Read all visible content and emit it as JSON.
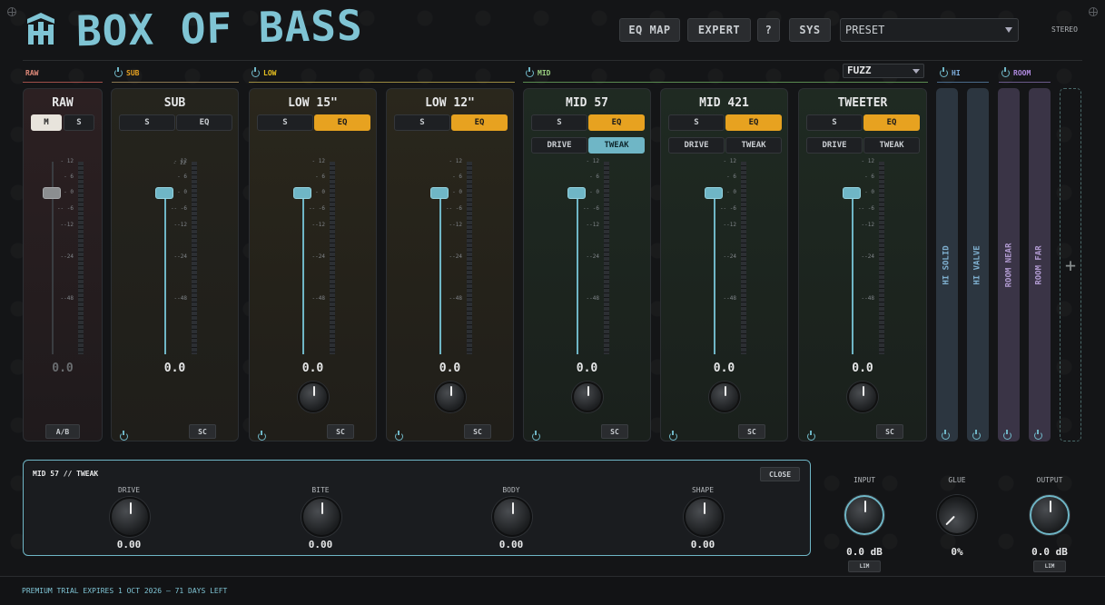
{
  "header": {
    "title": "BOX OF BASS",
    "buttons": [
      "EQ MAP",
      "EXPERT",
      "?",
      "SYS"
    ],
    "preset": "PRESET",
    "mode": "STEREO"
  },
  "groups": {
    "raw": "RAW",
    "sub": "SUB",
    "low": "LOW",
    "mid": "MID",
    "amp_model": "FUZZ",
    "hi": "HI",
    "room": "ROOM"
  },
  "scale": [
    "- 12",
    "- 6",
    "- 0",
    "-- -6",
    "--12",
    "--24",
    "--48"
  ],
  "channels": {
    "raw": {
      "title": "RAW",
      "m": "M",
      "s": "S",
      "value": "0.0",
      "ab": "A/B"
    },
    "sub": {
      "title": "SUB",
      "s": "S",
      "eq": "EQ",
      "value": "0.0",
      "sc": "SC"
    },
    "low15": {
      "title": "LOW 15\"",
      "s": "S",
      "eq": "EQ",
      "value": "0.0",
      "sc": "SC"
    },
    "low12": {
      "title": "LOW 12\"",
      "s": "S",
      "eq": "EQ",
      "value": "0.0",
      "sc": "SC"
    },
    "mid57": {
      "title": "MID 57",
      "s": "S",
      "eq": "EQ",
      "drive": "DRIVE",
      "tweak": "TWEAK",
      "value": "0.0",
      "sc": "SC"
    },
    "mid421": {
      "title": "MID 421",
      "s": "S",
      "eq": "EQ",
      "drive": "DRIVE",
      "tweak": "TWEAK",
      "value": "0.0",
      "sc": "SC"
    },
    "tweeter": {
      "title": "TWEETER",
      "s": "S",
      "eq": "EQ",
      "drive": "DRIVE",
      "tweak": "TWEAK",
      "value": "0.0",
      "sc": "SC"
    }
  },
  "strips": {
    "hi_solid": "HI SOLID",
    "hi_valve": "HI VALVE",
    "room_near": "ROOM NEAR",
    "room_far": "ROOM FAR",
    "add": "+"
  },
  "tweak_panel": {
    "title": "MID 57 // TWEAK",
    "close": "CLOSE",
    "params": [
      {
        "label": "DRIVE",
        "value": "0.00"
      },
      {
        "label": "BITE",
        "value": "0.00"
      },
      {
        "label": "BODY",
        "value": "0.00"
      },
      {
        "label": "SHAPE",
        "value": "0.00"
      }
    ]
  },
  "master": {
    "input_label": "INPUT",
    "input_value": "0.0 dB",
    "glue_label": "GLUE",
    "glue_value": "0%",
    "output_label": "OUTPUT",
    "output_value": "0.0 dB",
    "lim": "LIM"
  },
  "footer": {
    "trial": "PREMIUM TRIAL EXPIRES 1 OCT 2026 – 71 DAYS LEFT"
  },
  "colors": {
    "accent_cyan": "#6fb6c6",
    "accent_orange": "#e7a220",
    "raw_tint": "#2c2022",
    "sub_tint": "#25241d",
    "low_tint": "#2a271c",
    "mid_tint": "#1f2a22",
    "hi_tint": "#2c3640",
    "room_tint": "#3a3446"
  }
}
